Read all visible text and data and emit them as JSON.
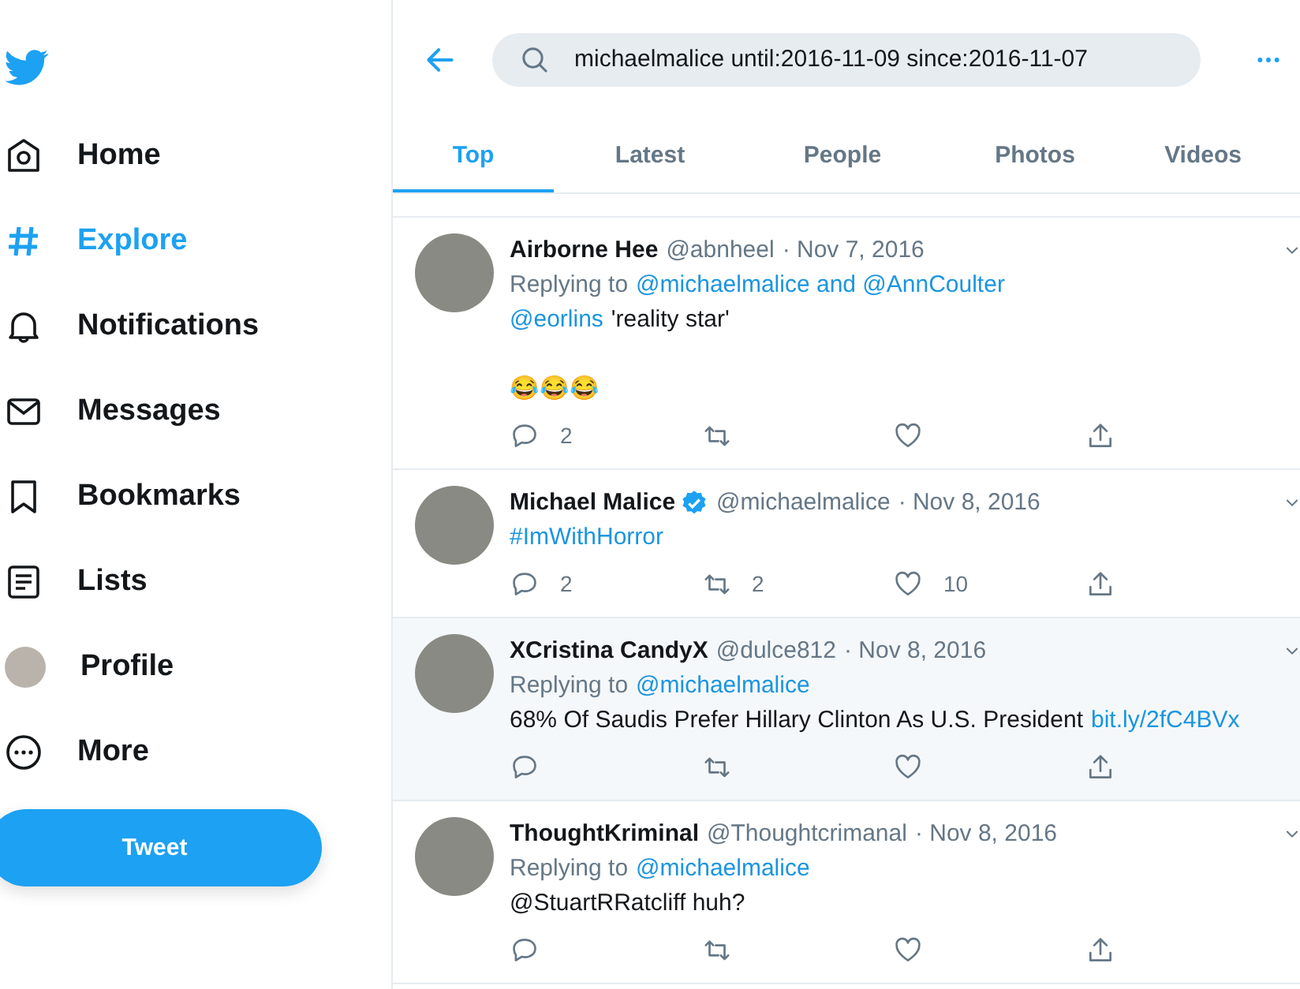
{
  "sidebar": {
    "nav": [
      {
        "kind": "home",
        "label": "Home",
        "selected": false
      },
      {
        "kind": "hash",
        "label": "Explore",
        "selected": true
      },
      {
        "kind": "bell",
        "label": "Notifications",
        "selected": false
      },
      {
        "kind": "mail",
        "label": "Messages",
        "selected": false
      },
      {
        "kind": "bookmark",
        "label": "Bookmarks",
        "selected": false
      },
      {
        "kind": "list",
        "label": "Lists",
        "selected": false
      },
      {
        "kind": "avatar",
        "label": "Profile",
        "selected": false
      },
      {
        "kind": "more",
        "label": "More",
        "selected": false
      }
    ],
    "tweet_button": "Tweet"
  },
  "search": {
    "value": "michaelmalice until:2016-11-09 since:2016-11-07"
  },
  "tabs": [
    {
      "label": "Top",
      "selected": true
    },
    {
      "label": "Latest",
      "selected": false
    },
    {
      "label": "People",
      "selected": false
    },
    {
      "label": "Photos",
      "selected": false
    },
    {
      "label": "Videos",
      "selected": false
    }
  ],
  "tweets": [
    {
      "name": "Airborne Hee",
      "verified": false,
      "handle": "@abnheel",
      "date": "· Nov 7, 2016",
      "hovered": false,
      "reply_prefix": "Replying to",
      "reply_targets": "@michaelmalice and @AnnCoulter",
      "body": [
        [
          {
            "kind": "link",
            "text": "@eorlins"
          },
          {
            "kind": "text",
            "text": "'reality star'"
          }
        ],
        [
          {
            "kind": "emoji",
            "text": "😂😂😂"
          }
        ]
      ],
      "actions": [
        {
          "kind": "reply",
          "count": "2"
        },
        {
          "kind": "retweet"
        },
        {
          "kind": "like"
        },
        {
          "kind": "share"
        }
      ]
    },
    {
      "name": "Michael Malice",
      "verified": true,
      "handle": "@michaelmalice",
      "date": "· Nov 8, 2016",
      "hovered": false,
      "body": [
        [
          {
            "kind": "link",
            "text": "#ImWithHorror"
          }
        ]
      ],
      "actions": [
        {
          "kind": "reply",
          "count": "2"
        },
        {
          "kind": "retweet",
          "count": "2"
        },
        {
          "kind": "like",
          "count": "10"
        },
        {
          "kind": "share"
        }
      ]
    },
    {
      "name": "XCristina CandyX",
      "verified": false,
      "handle": "@dulce812",
      "date": "· Nov 8, 2016",
      "hovered": true,
      "reply_prefix": "Replying to",
      "reply_targets": "@michaelmalice",
      "body": [
        [
          {
            "kind": "text",
            "text": "68% Of Saudis Prefer Hillary Clinton As U.S. President"
          },
          {
            "kind": "link",
            "text": "bit.ly/2fC4BVx"
          }
        ]
      ],
      "actions": [
        {
          "kind": "reply"
        },
        {
          "kind": "retweet"
        },
        {
          "kind": "like"
        },
        {
          "kind": "share"
        }
      ]
    },
    {
      "name": "ThoughtKriminal",
      "verified": false,
      "handle": "@Thoughtcrimanal",
      "date": "· Nov 8, 2016",
      "hovered": false,
      "reply_prefix": "Replying to",
      "reply_targets": "@michaelmalice",
      "body": [
        [
          {
            "kind": "text",
            "text": "@StuartRRatcliff huh?"
          }
        ]
      ],
      "actions": [
        {
          "kind": "reply"
        },
        {
          "kind": "retweet"
        },
        {
          "kind": "like"
        },
        {
          "kind": "share"
        }
      ]
    }
  ]
}
